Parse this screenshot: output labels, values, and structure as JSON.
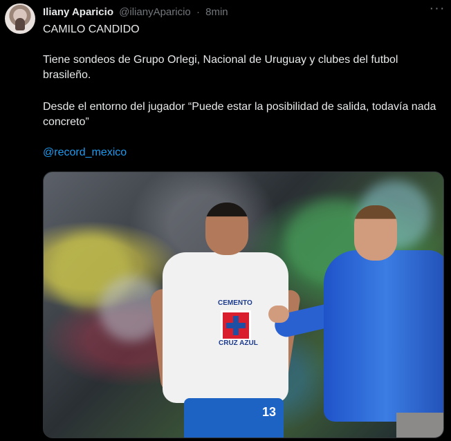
{
  "author": {
    "name": "Iliany Aparicio",
    "handle": "@ilianyAparicio",
    "time": "8min"
  },
  "tweet": {
    "line1": "CAMILO CANDIDO",
    "line2": "Tiene sondeos de Grupo Orlegi, Nacional de Uruguay y clubes del futbol brasileño.",
    "line3": "Desde el entorno del jugador “Puede estar la posibilidad de salida, todavía nada concreto”",
    "mention": "@record_mexico"
  },
  "media": {
    "sponsor_top": "CEMENTO",
    "sponsor_bottom": "CRUZ AZUL",
    "player_number": "13"
  },
  "icons": {
    "more": "more-icon"
  }
}
